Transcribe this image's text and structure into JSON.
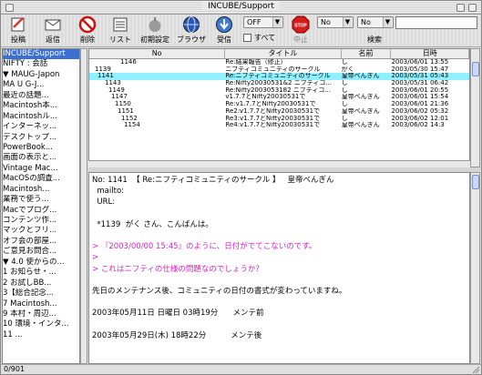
{
  "window": {
    "title": "INCUBE/Support"
  },
  "toolbar": {
    "post": "投稿",
    "reply_all": "返信",
    "delete": "削除",
    "list": "リスト",
    "initial_settings": "初期設定",
    "browser": "ブラウザ",
    "receive": "受信",
    "stop": "中止",
    "off_value": "OFF",
    "no_value_1": "No",
    "no_value_2": "No",
    "all_label": "すべて",
    "search_label": "検索",
    "search_value": ""
  },
  "tree": {
    "items": [
      {
        "label": "INCUBE/Support",
        "selected": true
      },
      {
        "label": "NIFTY : 会話"
      },
      {
        "label": "▼ MAUG-Japon"
      },
      {
        "label": "  MA U G-J..."
      },
      {
        "label": "  最近の話題..."
      },
      {
        "label": "  Macintosh本..."
      },
      {
        "label": "  Macintoshル..."
      },
      {
        "label": "  インターネッ..."
      },
      {
        "label": "  デスクトップ..."
      },
      {
        "label": "  PowerBook..."
      },
      {
        "label": "  画面の表示と..."
      },
      {
        "label": "  Vintage Mac..."
      },
      {
        "label": "  MacOSの調査..."
      },
      {
        "label": "  Macintosh..."
      },
      {
        "label": "  業務で使う..."
      },
      {
        "label": "  Macでプログ..."
      },
      {
        "label": "  コンテンツ作..."
      },
      {
        "label": "  マックとフリ..."
      },
      {
        "label": "  オフ会の部屋..."
      },
      {
        "label": "  ご意見お問合..."
      },
      {
        "label": "▼ 4.0 使からの..."
      },
      {
        "label": "    1 お知らせ・..."
      },
      {
        "label": "    2 お試しBB..."
      },
      {
        "label": "    3【総合記念..."
      },
      {
        "label": "    7 Macintosh..."
      },
      {
        "label": "    9 本村・周辺..."
      },
      {
        "label": "    10 環境・インタ..."
      },
      {
        "label": "    11 ..."
      }
    ]
  },
  "list": {
    "headers": [
      "No",
      "タイトル",
      "名前",
      "日時"
    ],
    "rows": [
      {
        "no": "1146",
        "title": "Re:結果報告（修正）",
        "name": "し",
        "date": "2003/06/01 13:55",
        "indent": 34
      },
      {
        "no": "1139",
        "title": "ニフティコミュニティのサークル",
        "name": "がく",
        "date": "2003/05/30 15:47",
        "indent": 6
      },
      {
        "no": "1141",
        "title": "Re:ニフティコミュニティのサークル",
        "name": "皇帝べんぎん",
        "date": "2003/05/31 05:43",
        "indent": 9,
        "selected": true
      },
      {
        "no": "1143",
        "title": "Re:Nifty20030531&2 ニフティコ...",
        "name": "し",
        "date": "2003/05/31 06:42",
        "indent": 17
      },
      {
        "no": "1149",
        "title": "Re:Nifty2003053182 ニフティコ...",
        "name": "し",
        "date": "2003/06/01 20:55",
        "indent": 21
      },
      {
        "no": "1147",
        "title": "v1.7.7とNifty20030531で",
        "name": "皇帝べんぎん",
        "date": "2003/06/01 15:54",
        "indent": 24
      },
      {
        "no": "1150",
        "title": "Re:v1.7.7とNifty20030531で",
        "name": "し",
        "date": "2003/06/01 21:36",
        "indent": 28
      },
      {
        "no": "1151",
        "title": "Re2:v1.7.7とNifty20030531で",
        "name": "皇帝べんぎん",
        "date": "2003/06/02 05:32",
        "indent": 31
      },
      {
        "no": "1152",
        "title": "Re3:v1.7.7とNifty20030531で",
        "name": "し",
        "date": "2003/06/02 12:01",
        "indent": 35
      },
      {
        "no": "1154",
        "title": "Re4:v1.7.7とNifty20030531で",
        "name": "皇帝べんぎん",
        "date": "2003/06/02 14:3",
        "indent": 38
      }
    ]
  },
  "message": {
    "header": "No: 1141  【 Re:ニフティコミュニティのサークル 】   皇帝べんぎん",
    "mailto": "  mailto:",
    "url": "  URL:",
    "lines": [
      {
        "text": "",
        "quote": false
      },
      {
        "text": "  *1139  がく さん、こんばんは。",
        "quote": false
      },
      {
        "text": "",
        "quote": false
      },
      {
        "text": "> 『2003/00/00 15:45』のように、日付がでてこないのです。",
        "quote": true
      },
      {
        "text": ">",
        "quote": true
      },
      {
        "text": "> これはニフティの仕様の問題なのでしょうか？",
        "quote": true
      },
      {
        "text": "",
        "quote": false
      },
      {
        "text": "先日のメンテナンス後、コミュニティの日付の書式が変わっていますね。",
        "quote": false
      },
      {
        "text": "",
        "quote": false
      },
      {
        "text": "2003年05月11日 日曜日 03時19分      メンテ前",
        "quote": false
      },
      {
        "text": "",
        "quote": false
      },
      {
        "text": "2003年05月29日(木) 18時22分          メンテ後",
        "quote": false
      },
      {
        "text": "",
        "quote": false
      },
      {
        "text": "",
        "quote": false
      },
      {
        "text": "                皇帝べんぎん  from Tokyo with INCUBE v1.7.7PPC",
        "quote": false
      }
    ]
  },
  "status": {
    "text": "0/901"
  },
  "colors": {
    "selection": "#3b6fd0",
    "list_selection": "#8ff0ff",
    "quote": "#d822c5"
  }
}
